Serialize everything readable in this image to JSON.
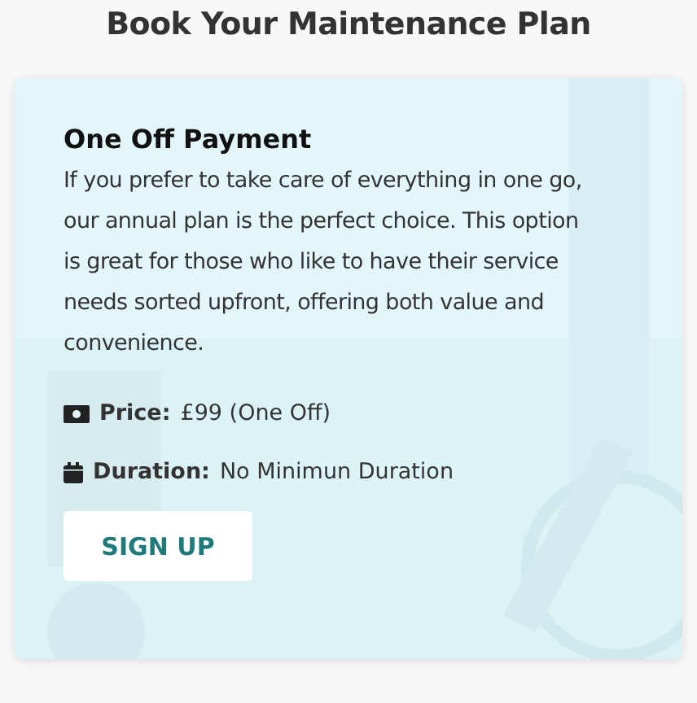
{
  "title": "Book Your Maintenance Plan",
  "card": {
    "kind": "picture",
    "heading": "One Off Payment",
    "description": "If you prefer to take care of everything in one go, our annual plan is the perfect choice. This option is great for those who like to have their service needs sorted upfront, offering both value and convenience.",
    "details": [
      {
        "kind": "money",
        "label": "Price:",
        "value": "£99 (One Off)"
      },
      {
        "kind": "calendar",
        "label": "Duration:",
        "value": "No Minimun Duration"
      }
    ],
    "button": "SIGN UP"
  }
}
